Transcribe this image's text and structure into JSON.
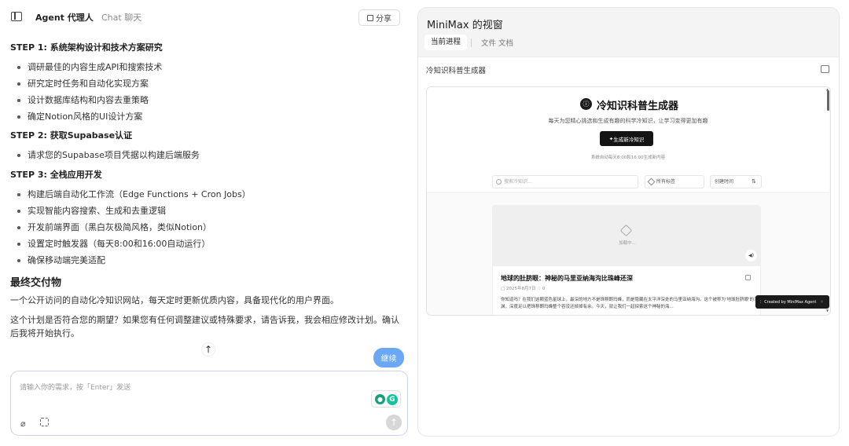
{
  "header": {
    "tab_agent": "Agent  代理人",
    "tab_chat": "Chat  聊天",
    "share_label": "分享"
  },
  "message": {
    "steps": [
      {
        "title": "STEP 1: 系统架构设计和技术方案研究",
        "items": [
          "调研最佳的内容生成API和搜索技术",
          "研究定时任务和自动化实现方案",
          "设计数据库结构和内容去重策略",
          "确定Notion风格的UI设计方案"
        ]
      },
      {
        "title": "STEP 2: 获取Supabase认证",
        "items": [
          "请求您的Supabase项目凭据以构建后端服务"
        ]
      },
      {
        "title": "STEP 3: 全栈应用开发",
        "items": [
          "构建后端自动化工作流（Edge Functions + Cron Jobs）",
          "实现智能内容搜索、生成和去重逻辑",
          "开发前端界面（黑白灰极简风格，类似Notion）",
          "设置定时触发器（每天8:00和16:00自动运行）",
          "确保移动端完美适配"
        ]
      }
    ],
    "deliverable_title": "最终交付物",
    "deliverable_text": "一个公开访问的自动化冷知识网站，每天定时更新优质内容，具备现代化的用户界面。",
    "closing_text": "这个计划是否符合您的期望？如果您有任何调整建议或特殊要求，请告诉我，我会相应修改计划。确认后我将开始执行。"
  },
  "continue_label": "继续",
  "input": {
    "placeholder": "请输入你的需求，按「Enter」发送"
  },
  "right": {
    "title": "MiniMax 的视窗",
    "tab_current": "当前进程",
    "tab_files": "文件  文档",
    "file_title": "冷知识科普生成器"
  },
  "preview": {
    "app_title": "冷知识科普生成器",
    "app_subtitle": "每天为您精心挑选和生成有趣的科学冷知识，让学习变得更加有趣",
    "generate_label": "生成新冷知识",
    "auto_note": "系统自动每天8:00和16:00生成新内容",
    "search_placeholder": "搜索冷知识...",
    "tag_filter": "所有标签",
    "sort_label": "创建时间",
    "card": {
      "loading": "加载中...",
      "title": "地球的肚脐眼：神秘的马里亚纳海沟比珠峰还深",
      "date": "2025年8月7日",
      "likes": "0",
      "text": "你知道吗？在我们这颗蓝色星球上，最深的地方不是珠穆朗玛峰，而是隐藏在太平洋深处的马里亚纳海沟。这个被称为'地球肚脐眼'的深渊，深度足以把珠穆朗玛峰整个吞没还掉掉有余。今天，就让我们一起探索这个神秘的海..."
    },
    "badge": "Created by MiniMax Agent"
  }
}
